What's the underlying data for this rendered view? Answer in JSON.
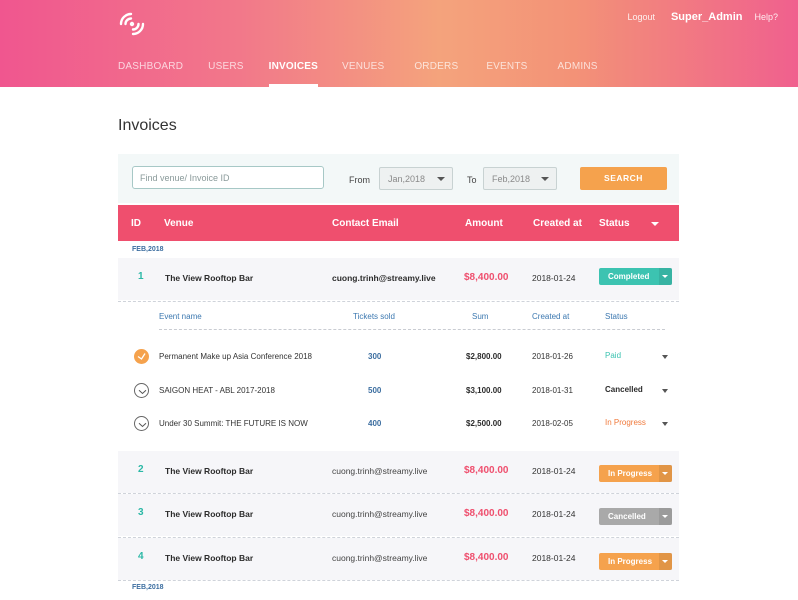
{
  "header": {
    "logout_label": "Logout",
    "username": "Super_Admin",
    "help_label": "Help?",
    "nav": [
      {
        "label": "DASHBOARD",
        "active": false
      },
      {
        "label": "USERS",
        "active": false
      },
      {
        "label": "INVOICES",
        "active": true
      },
      {
        "label": "VENUES",
        "active": false
      },
      {
        "label": "ORDERS",
        "active": false
      },
      {
        "label": "EVENTS",
        "active": false
      },
      {
        "label": "ADMINS",
        "active": false
      }
    ]
  },
  "page_title": "Invoices",
  "search": {
    "placeholder": "Find venue/ Invoice ID",
    "from_label": "From",
    "from_value": "Jan,2018",
    "to_label": "To",
    "to_value": "Feb,2018",
    "button_label": "SEARCH"
  },
  "table": {
    "columns": [
      "ID",
      "Venue",
      "Contact Email",
      "Amount",
      "Created at",
      "Status"
    ],
    "sections": [
      "FEB,2018",
      "FEB,2018"
    ],
    "rows": [
      {
        "id": "1",
        "venue": "The View Rooftop Bar",
        "email": "cuong.trinh@streamy.live",
        "amount": "$8,400.00",
        "created": "2018-01-24",
        "status": "Completed",
        "status_color": "#3cc3b1"
      },
      {
        "id": "2",
        "venue": "The View Rooftop Bar",
        "email": "cuong.trinh@streamy.live",
        "amount": "$8,400.00",
        "created": "2018-01-24",
        "status": "In Progress",
        "status_color": "#f5a24d"
      },
      {
        "id": "3",
        "venue": "The View Rooftop Bar",
        "email": "cuong.trinh@streamy.live",
        "amount": "$8,400.00",
        "created": "2018-01-24",
        "status": "Cancelled",
        "status_color": "#a9a9a9"
      },
      {
        "id": "4",
        "venue": "The View Rooftop Bar",
        "email": "cuong.trinh@streamy.live",
        "amount": "$8,400.00",
        "created": "2018-01-24",
        "status": "In Progress",
        "status_color": "#f5a24d"
      }
    ]
  },
  "detail": {
    "columns": [
      "Event name",
      "Tickets sold",
      "Sum",
      "Created at",
      "Status"
    ],
    "events": [
      {
        "name": "Permanent Make up Asia Conference 2018",
        "tickets": "300",
        "sum": "$2,800.00",
        "created": "2018-01-26",
        "status": "Paid",
        "status_color": "#3cc3b1",
        "checked": true
      },
      {
        "name": "SAIGON HEAT - ABL 2017-2018",
        "tickets": "500",
        "sum": "$3,100.00",
        "created": "2018-01-31",
        "status": "Cancelled",
        "status_color": "#2c2c2c",
        "checked": false
      },
      {
        "name": "Under 30 Summit: THE FUTURE IS NOW",
        "tickets": "400",
        "sum": "$2,500.00",
        "created": "2018-02-05",
        "status": "In Progress",
        "status_color": "#f07a3c",
        "checked": false
      }
    ]
  },
  "icons": {
    "logo": "streamy-logo-icon",
    "dropdown": "chevron-down-icon",
    "check": "check-circle-icon"
  },
  "colors": {
    "accent_pink": "#ef4f6e",
    "accent_orange": "#f5a24d",
    "teal": "#3cc3b1"
  }
}
